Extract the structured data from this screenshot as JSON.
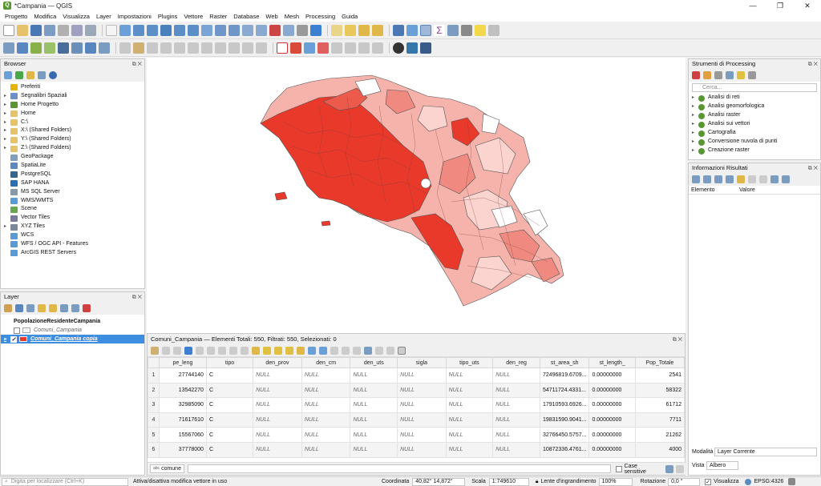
{
  "window": {
    "title": "*Campania — QGIS",
    "controls": [
      "—",
      "❐",
      "✕"
    ]
  },
  "menu": [
    "Progetto",
    "Modifica",
    "Visualizza",
    "Layer",
    "Impostazioni",
    "Plugins",
    "Vettore",
    "Raster",
    "Database",
    "Web",
    "Mesh",
    "Processing",
    "Guida"
  ],
  "browser": {
    "title": "Browser",
    "items": [
      {
        "label": "Preferiti",
        "icon": "star-icon",
        "color": "#e8b400",
        "arrow": ""
      },
      {
        "label": "Segnalibri Spaziali",
        "icon": "bookmark-icon",
        "color": "#6b8fc7",
        "arrow": "▸"
      },
      {
        "label": "Home Progetto",
        "icon": "project-home-icon",
        "color": "#589632",
        "arrow": "▸"
      },
      {
        "label": "Home",
        "icon": "folder-icon",
        "color": "#e6c36a",
        "arrow": "▸"
      },
      {
        "label": "C:\\",
        "icon": "folder-icon",
        "color": "#e6c36a",
        "arrow": "▸"
      },
      {
        "label": "X:\\ (Shared Folders)",
        "icon": "folder-icon",
        "color": "#e6c36a",
        "arrow": "▸"
      },
      {
        "label": "Y:\\ (Shared Folders)",
        "icon": "folder-icon",
        "color": "#e6c36a",
        "arrow": "▸"
      },
      {
        "label": "Z:\\ (Shared Folders)",
        "icon": "folder-icon",
        "color": "#e6c36a",
        "arrow": "▸"
      },
      {
        "label": "GeoPackage",
        "icon": "geopackage-icon",
        "color": "#7f9fbf",
        "arrow": ""
      },
      {
        "label": "SpatiaLite",
        "icon": "spatialite-icon",
        "color": "#5a8ac0",
        "arrow": ""
      },
      {
        "label": "PostgreSQL",
        "icon": "postgresql-icon",
        "color": "#336791",
        "arrow": ""
      },
      {
        "label": "SAP HANA",
        "icon": "sap-hana-icon",
        "color": "#2a6fb3",
        "arrow": ""
      },
      {
        "label": "MS SQL Server",
        "icon": "mssql-icon",
        "color": "#8899aa",
        "arrow": ""
      },
      {
        "label": "WMS/WMTS",
        "icon": "globe-icon",
        "color": "#5a9bd5",
        "arrow": ""
      },
      {
        "label": "Scene",
        "icon": "scene-icon",
        "color": "#6aa84f",
        "arrow": ""
      },
      {
        "label": "Vector Tiles",
        "icon": "vector-tiles-icon",
        "color": "#7a7a9a",
        "arrow": ""
      },
      {
        "label": "XYZ Tiles",
        "icon": "grid-icon",
        "color": "#7a8a9a",
        "arrow": "▸"
      },
      {
        "label": "WCS",
        "icon": "globe-icon",
        "color": "#5a9bd5",
        "arrow": ""
      },
      {
        "label": "WFS / OGC API - Features",
        "icon": "globe-icon",
        "color": "#5a9bd5",
        "arrow": ""
      },
      {
        "label": "ArcGIS REST Servers",
        "icon": "arcgis-icon",
        "color": "#5a9bd5",
        "arrow": ""
      }
    ]
  },
  "layers": {
    "title": "Layer",
    "items": [
      {
        "label": "PopolazioneResidenteCampania",
        "style": "bold",
        "checked": null
      },
      {
        "label": "Comuni_Campania",
        "style": "italic",
        "checked": false
      },
      {
        "label": "Comuni_Campania copia",
        "style": "selected",
        "checked": true
      }
    ]
  },
  "processing": {
    "title": "Strumenti di Processing",
    "search_placeholder": "Cerca...",
    "items": [
      "Analisi di reti",
      "Analisi geomorfologica",
      "Analisi raster",
      "Analisi sui vettori",
      "Cartografia",
      "Conversione nuvola di punti",
      "Creazione raster"
    ]
  },
  "results": {
    "title": "Informazioni Risultati",
    "col_element": "Elemento",
    "col_value": "Valore",
    "mode_label": "Modalità",
    "mode_value": "Layer Corrente",
    "view_label": "Vista",
    "view_value": "Albero"
  },
  "attribute_table": {
    "title": "Comuni_Campania — Elementi Totali: 550, Filtrati: 550, Selezionati: 0",
    "columns": [
      "pe_leng",
      "tipo",
      "den_prov",
      "den_cm",
      "den_uts",
      "sigla",
      "tipo_uts",
      "den_reg",
      "st_area_sh",
      "st_length_",
      "Pop_Totale"
    ],
    "rows": [
      [
        "1",
        "27744140",
        "C",
        "NULL",
        "NULL",
        "NULL",
        "NULL",
        "NULL",
        "NULL",
        "72496819.6709...",
        "0.00000000",
        "2541"
      ],
      [
        "2",
        "13542270",
        "C",
        "NULL",
        "NULL",
        "NULL",
        "NULL",
        "NULL",
        "NULL",
        "54711724.4331...",
        "0.00000000",
        "58322"
      ],
      [
        "3",
        "32985090",
        "C",
        "NULL",
        "NULL",
        "NULL",
        "NULL",
        "NULL",
        "NULL",
        "17910593.6926...",
        "0.00000000",
        "61712"
      ],
      [
        "4",
        "71617610",
        "C",
        "NULL",
        "NULL",
        "NULL",
        "NULL",
        "NULL",
        "NULL",
        "19831590.9041...",
        "0.00000000",
        "7711"
      ],
      [
        "5",
        "15567060",
        "C",
        "NULL",
        "NULL",
        "NULL",
        "NULL",
        "NULL",
        "NULL",
        "32766450.5757...",
        "0.00000000",
        "21262"
      ],
      [
        "6",
        "37778000",
        "C",
        "NULL",
        "NULL",
        "NULL",
        "NULL",
        "NULL",
        "NULL",
        "10872336.4761...",
        "0.00000000",
        "4000"
      ]
    ],
    "filter_field": "comune",
    "case_sensitive": "Case sensitive"
  },
  "status": {
    "search_placeholder": "Digita per localizzare (Ctrl+K)",
    "message": "Attiva/disattiva modifica vettore in uso",
    "coord_label": "Coordinata",
    "coord_value": "40,82° 14,872°",
    "scale_label": "Scala",
    "scale_value": "1:749610",
    "magnifier_label": "Lente d'ingrandimento",
    "magnifier_value": "100%",
    "rotation_label": "Rotazione",
    "rotation_value": "0,0 °",
    "render_label": "Visualizza",
    "crs": "EPSG:4326"
  },
  "colors": {
    "qgis_green": "#589632",
    "selection": "#3d8ee0",
    "choropleth_dark": "#e8392b",
    "choropleth_mid": "#f08a80",
    "choropleth_light": "#fbd4d0"
  }
}
